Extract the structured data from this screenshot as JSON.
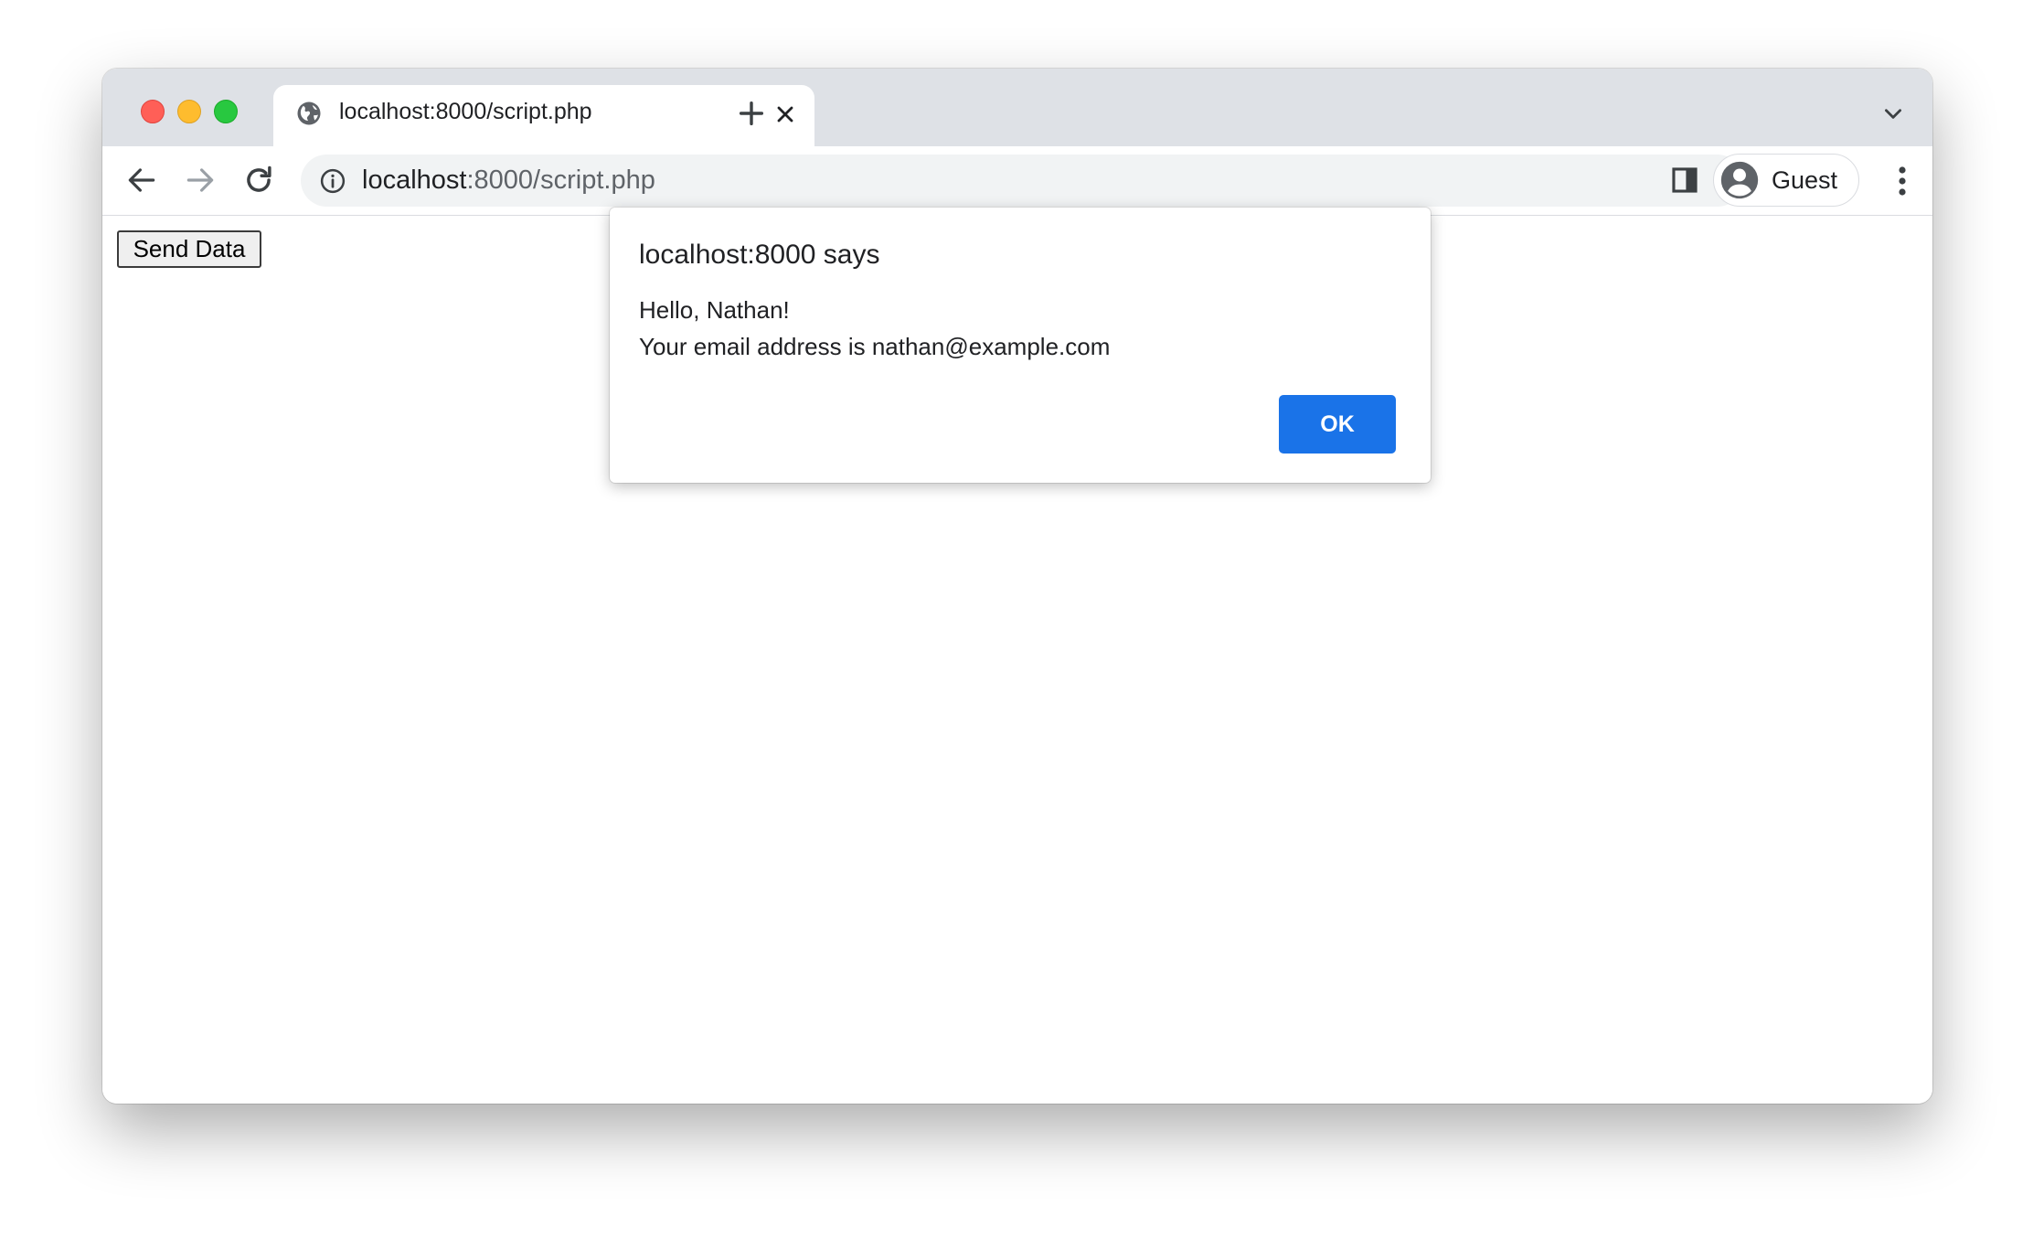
{
  "browser": {
    "tab": {
      "title": "localhost:8000/script.php",
      "favicon_icon": "globe-icon",
      "close_icon": "close-icon"
    },
    "new_tab_icon": "plus-icon",
    "tab_menu_icon": "chevron-down-icon",
    "toolbar": {
      "back_icon": "arrow-left-icon",
      "forward_icon": "arrow-right-icon",
      "reload_icon": "reload-icon",
      "omnibox": {
        "info_icon": "info-icon",
        "url_host": "localhost",
        "url_rest": ":8000/script.php"
      },
      "side_panel_icon": "side-panel-icon",
      "profile": {
        "avatar_icon": "account-circle-icon",
        "name": "Guest"
      },
      "menu_icon": "kebab-menu-icon"
    }
  },
  "page": {
    "send_button_label": "Send Data"
  },
  "dialog": {
    "title": "localhost:8000 says",
    "message_line1": "Hello, Nathan!",
    "message_line2": "Your email address is nathan@example.com",
    "ok_label": "OK",
    "ok_color": "#1a73e8"
  }
}
